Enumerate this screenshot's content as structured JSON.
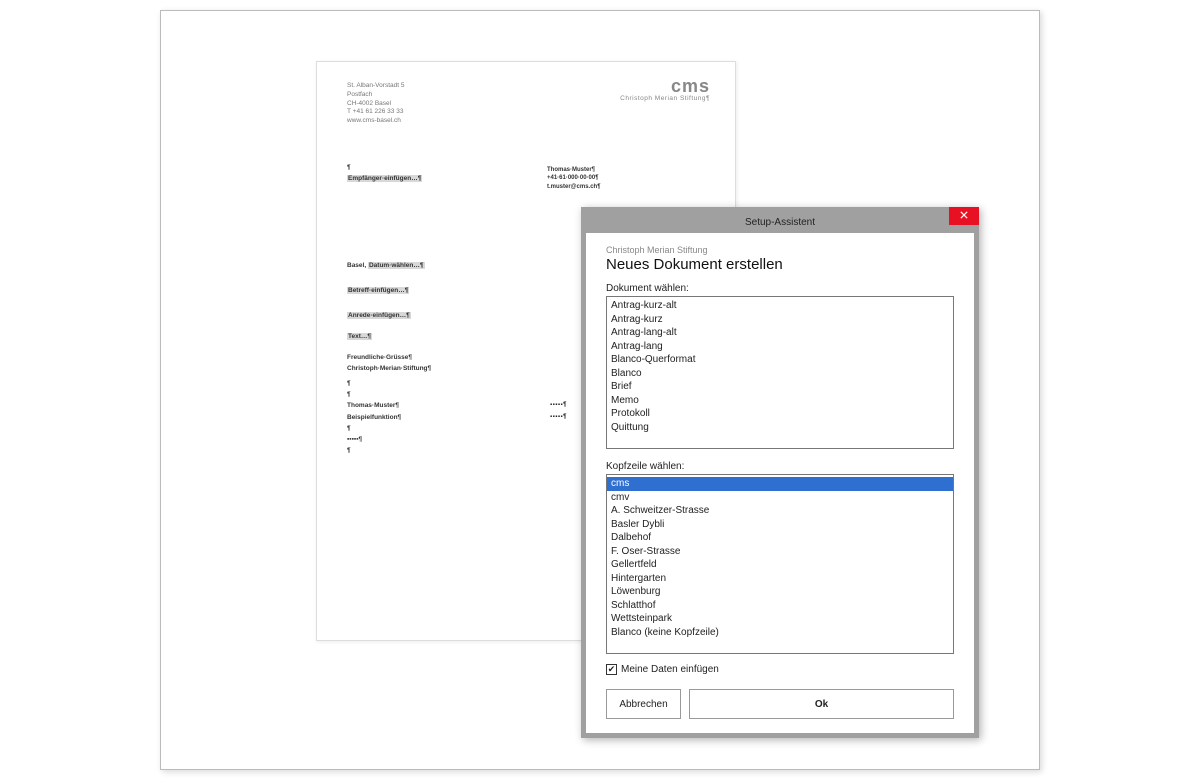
{
  "sender": {
    "line1": "St. Alban-Vorstadt 5",
    "line2": "Postfach",
    "line3": "CH-4002 Basel",
    "line4": "T +41 61 226 33 33",
    "line5": "www.cms-basel.ch"
  },
  "logo": {
    "big": "cms",
    "sub": "Christoph Merian Stiftung¶"
  },
  "contact": {
    "name": "Thomas·Muster¶",
    "phone": "+41·61·000·00·00¶",
    "mail": "t.muster@cms.ch¶"
  },
  "body": {
    "pil1": "¶",
    "recip": "Empfänger·einfügen…¶",
    "dateline_prefix": "Basel, ",
    "dateline_ph": "Datum·wählen…¶",
    "subject": "Betreff·einfügen…¶",
    "salut": "Anrede·einfügen…¶",
    "text": "Text…¶",
    "greet": "Freundliche·Grüsse¶",
    "org": "Christoph·Merian·Stiftung¶",
    "sig_name": "Thomas·Muster¶",
    "sig_func": "Beispielfunktion¶",
    "dots": "▪▪▪▪▪¶"
  },
  "dialog": {
    "title": "Setup-Assistent",
    "org": "Christoph Merian Stiftung",
    "heading": "Neues Dokument erstellen",
    "label_doc": "Dokument wählen:",
    "docs": [
      "Antrag-kurz-alt",
      "Antrag-kurz",
      "Antrag-lang-alt",
      "Antrag-lang",
      "Blanco-Querformat",
      "Blanco",
      "Brief",
      "Memo",
      "Protokoll",
      "Quittung"
    ],
    "label_head": "Kopfzeile wählen:",
    "heads": [
      "cms",
      "cmv",
      "A. Schweitzer-Strasse",
      "Basler Dybli",
      "Dalbehof",
      "F. Oser-Strasse",
      "Gellertfeld",
      "Hintergarten",
      "Löwenburg",
      "Schlatthof",
      "Wettsteinpark",
      "Blanco (keine Kopfzeile)"
    ],
    "head_selected": "cms",
    "check_label": "Meine Daten einfügen",
    "check_checked": true,
    "cancel": "Abbrechen",
    "ok": "Ok"
  }
}
